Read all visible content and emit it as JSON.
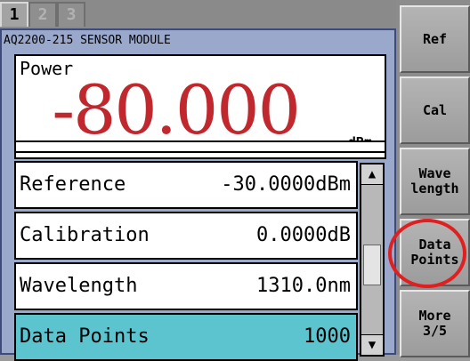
{
  "tabs": [
    "1",
    "2",
    "3"
  ],
  "module_title": "AQ2200-215 SENSOR MODULE",
  "power": {
    "label": "Power",
    "value": "-80.000",
    "unit": "dBm",
    "value_color": "#c0282e"
  },
  "list": {
    "rows": [
      {
        "label": "Reference",
        "value": "-30.0000dBm"
      },
      {
        "label": "Calibration",
        "value": "0.0000dB"
      },
      {
        "label": "Wavelength",
        "value": "1310.0nm"
      },
      {
        "label": "Data Points",
        "value": "1000"
      }
    ],
    "selected_index": 3,
    "selected_color": "#5cc4ce"
  },
  "scrollbar": {
    "up_icon": "▲",
    "down_icon": "▼"
  },
  "softkeys": [
    {
      "label": "Ref"
    },
    {
      "label": "Cal"
    },
    {
      "label": "Wave\nlength"
    },
    {
      "label": "Data\nPoints"
    },
    {
      "label": "More\n3/5"
    }
  ],
  "highlight_color": "#e02020"
}
